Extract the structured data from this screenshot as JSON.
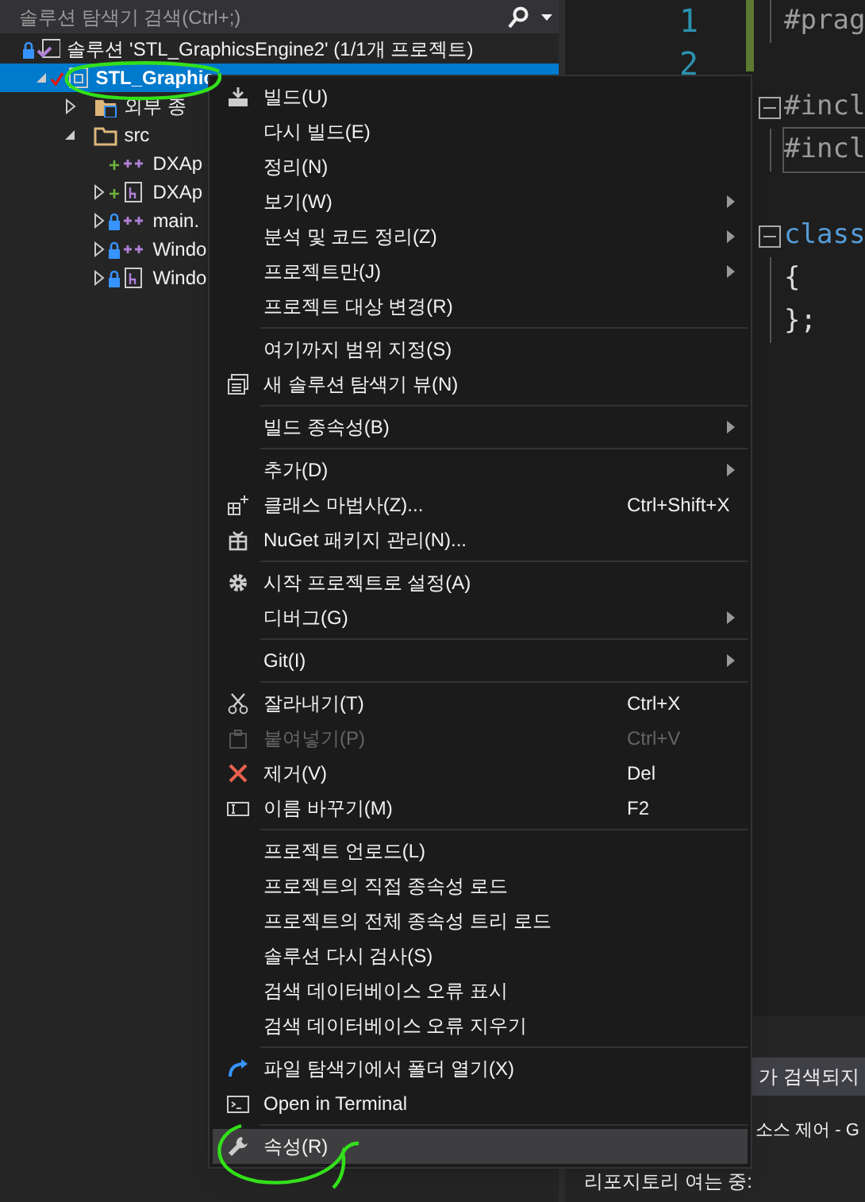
{
  "explorer": {
    "search": {
      "placeholder": "솔루션 탐색기 검색(Ctrl+;)"
    },
    "tree": [
      {
        "kind": "solution",
        "label": "솔루션 'STL_GraphicsEngine2' (1/1개 프로젝트)",
        "locked": true,
        "added": false,
        "checked": false,
        "selected": false,
        "children": [
          {
            "kind": "project",
            "label": "STL_Graphic",
            "locked": false,
            "added": false,
            "checked": true,
            "expanded": true,
            "selected": true,
            "children": [
              {
                "kind": "deps",
                "label": "외부 종",
                "locked": false,
                "added": false,
                "checked": false,
                "expanded": false,
                "selected": false
              },
              {
                "kind": "folder",
                "label": "src",
                "locked": false,
                "added": false,
                "checked": false,
                "expanded": true,
                "selected": false,
                "children": [
                  {
                    "kind": "source",
                    "label": "DXAp",
                    "locked": false,
                    "added": true,
                    "checked": false,
                    "selected": false
                  },
                  {
                    "kind": "header",
                    "label": "DXAp",
                    "locked": false,
                    "added": true,
                    "checked": false,
                    "expanded": false,
                    "selected": false
                  },
                  {
                    "kind": "source",
                    "label": "main.",
                    "locked": true,
                    "added": false,
                    "checked": false,
                    "expanded": false,
                    "selected": false
                  },
                  {
                    "kind": "source",
                    "label": "Windo",
                    "locked": true,
                    "added": false,
                    "checked": false,
                    "expanded": false,
                    "selected": false
                  },
                  {
                    "kind": "header",
                    "label": "Windo",
                    "locked": true,
                    "added": false,
                    "checked": false,
                    "expanded": false,
                    "selected": false
                  }
                ]
              }
            ]
          }
        ]
      }
    ]
  },
  "editor": {
    "line_numbers": [
      "1",
      "2"
    ],
    "code_lines": [
      {
        "kind": "preprocessor",
        "text": "#prag",
        "fold": false,
        "highlighted": false
      },
      {
        "kind": "blank"
      },
      {
        "kind": "preprocessor",
        "text": "#incl",
        "fold": true,
        "highlighted": false
      },
      {
        "kind": "preprocessor",
        "text": "#incl",
        "fold": false,
        "highlighted": true
      },
      {
        "kind": "blank"
      },
      {
        "kind": "keyword",
        "text": "class",
        "fold": true,
        "highlighted": false
      },
      {
        "kind": "plain",
        "text": "{",
        "fold": false,
        "highlighted": false
      },
      {
        "kind": "plain",
        "text": "};",
        "fold": false,
        "highlighted": false
      }
    ]
  },
  "bottom": {
    "error_bar": "가 검색되지",
    "tab": "소스 제어 - G",
    "output": "리포지토리 여는 중:"
  },
  "context_menu": [
    {
      "items": [
        {
          "kind": "build",
          "label": "빌드(U)",
          "disabled": false,
          "selected": false,
          "submenu": false
        },
        {
          "kind": "plain",
          "label": "다시 빌드(E)",
          "disabled": false,
          "selected": false,
          "submenu": false
        },
        {
          "kind": "plain",
          "label": "정리(N)",
          "disabled": false,
          "selected": false,
          "submenu": false
        },
        {
          "kind": "plain",
          "label": "보기(W)",
          "disabled": false,
          "selected": false,
          "submenu": true
        },
        {
          "kind": "plain",
          "label": "분석 및 코드 정리(Z)",
          "disabled": false,
          "selected": false,
          "submenu": true
        },
        {
          "kind": "plain",
          "label": "프로젝트만(J)",
          "disabled": false,
          "selected": false,
          "submenu": true
        },
        {
          "kind": "plain",
          "label": "프로젝트 대상 변경(R)",
          "disabled": false,
          "selected": false,
          "submenu": false
        }
      ]
    },
    {
      "items": [
        {
          "kind": "plain",
          "label": "여기까지 범위 지정(S)",
          "disabled": false,
          "selected": false,
          "submenu": false
        },
        {
          "kind": "view",
          "label": "새 솔루션 탐색기 뷰(N)",
          "disabled": false,
          "selected": false,
          "submenu": false
        }
      ]
    },
    {
      "items": [
        {
          "kind": "plain",
          "label": "빌드 종속성(B)",
          "disabled": false,
          "selected": false,
          "submenu": true
        }
      ]
    },
    {
      "items": [
        {
          "kind": "plain",
          "label": "추가(D)",
          "disabled": false,
          "selected": false,
          "submenu": true
        },
        {
          "kind": "wizard",
          "label": "클래스 마법사(Z)...",
          "shortcut": "Ctrl+Shift+X",
          "disabled": false,
          "selected": false,
          "submenu": false
        },
        {
          "kind": "package",
          "label": "NuGet 패키지 관리(N)...",
          "disabled": false,
          "selected": false,
          "submenu": false
        }
      ]
    },
    {
      "items": [
        {
          "kind": "gear",
          "label": "시작 프로젝트로 설정(A)",
          "disabled": false,
          "selected": false,
          "submenu": false
        },
        {
          "kind": "plain",
          "label": "디버그(G)",
          "disabled": false,
          "selected": false,
          "submenu": true
        }
      ]
    },
    {
      "items": [
        {
          "kind": "plain",
          "label": "Git(I)",
          "disabled": false,
          "selected": false,
          "submenu": true
        }
      ]
    },
    {
      "items": [
        {
          "kind": "cut",
          "label": "잘라내기(T)",
          "shortcut": "Ctrl+X",
          "disabled": false,
          "selected": false,
          "submenu": false
        },
        {
          "kind": "paste",
          "label": "붙여넣기(P)",
          "shortcut": "Ctrl+V",
          "disabled": true,
          "selected": false,
          "submenu": false
        },
        {
          "kind": "remove",
          "label": "제거(V)",
          "shortcut": "Del",
          "disabled": false,
          "selected": false,
          "submenu": false
        },
        {
          "kind": "rename",
          "label": "이름 바꾸기(M)",
          "shortcut": "F2",
          "disabled": false,
          "selected": false,
          "submenu": false
        }
      ]
    },
    {
      "items": [
        {
          "kind": "plain",
          "label": "프로젝트 언로드(L)",
          "disabled": false,
          "selected": false,
          "submenu": false
        },
        {
          "kind": "plain",
          "label": "프로젝트의 직접 종속성 로드",
          "disabled": false,
          "selected": false,
          "submenu": false
        },
        {
          "kind": "plain",
          "label": "프로젝트의 전체 종속성 트리 로드",
          "disabled": false,
          "selected": false,
          "submenu": false
        },
        {
          "kind": "plain",
          "label": "솔루션 다시 검사(S)",
          "disabled": false,
          "selected": false,
          "submenu": false
        },
        {
          "kind": "plain",
          "label": "검색 데이터베이스 오류 표시",
          "disabled": false,
          "selected": false,
          "submenu": false
        },
        {
          "kind": "plain",
          "label": "검색 데이터베이스 오류 지우기",
          "disabled": false,
          "selected": false,
          "submenu": false
        }
      ]
    },
    {
      "items": [
        {
          "kind": "open",
          "label": "파일 탐색기에서 폴더 열기(X)",
          "disabled": false,
          "selected": false,
          "submenu": false
        },
        {
          "kind": "terminal",
          "label": "Open in Terminal",
          "disabled": false,
          "selected": false,
          "submenu": false
        }
      ]
    },
    {
      "items": [
        {
          "kind": "wrench",
          "label": "속성(R)",
          "disabled": false,
          "selected": true,
          "submenu": false
        }
      ]
    }
  ]
}
